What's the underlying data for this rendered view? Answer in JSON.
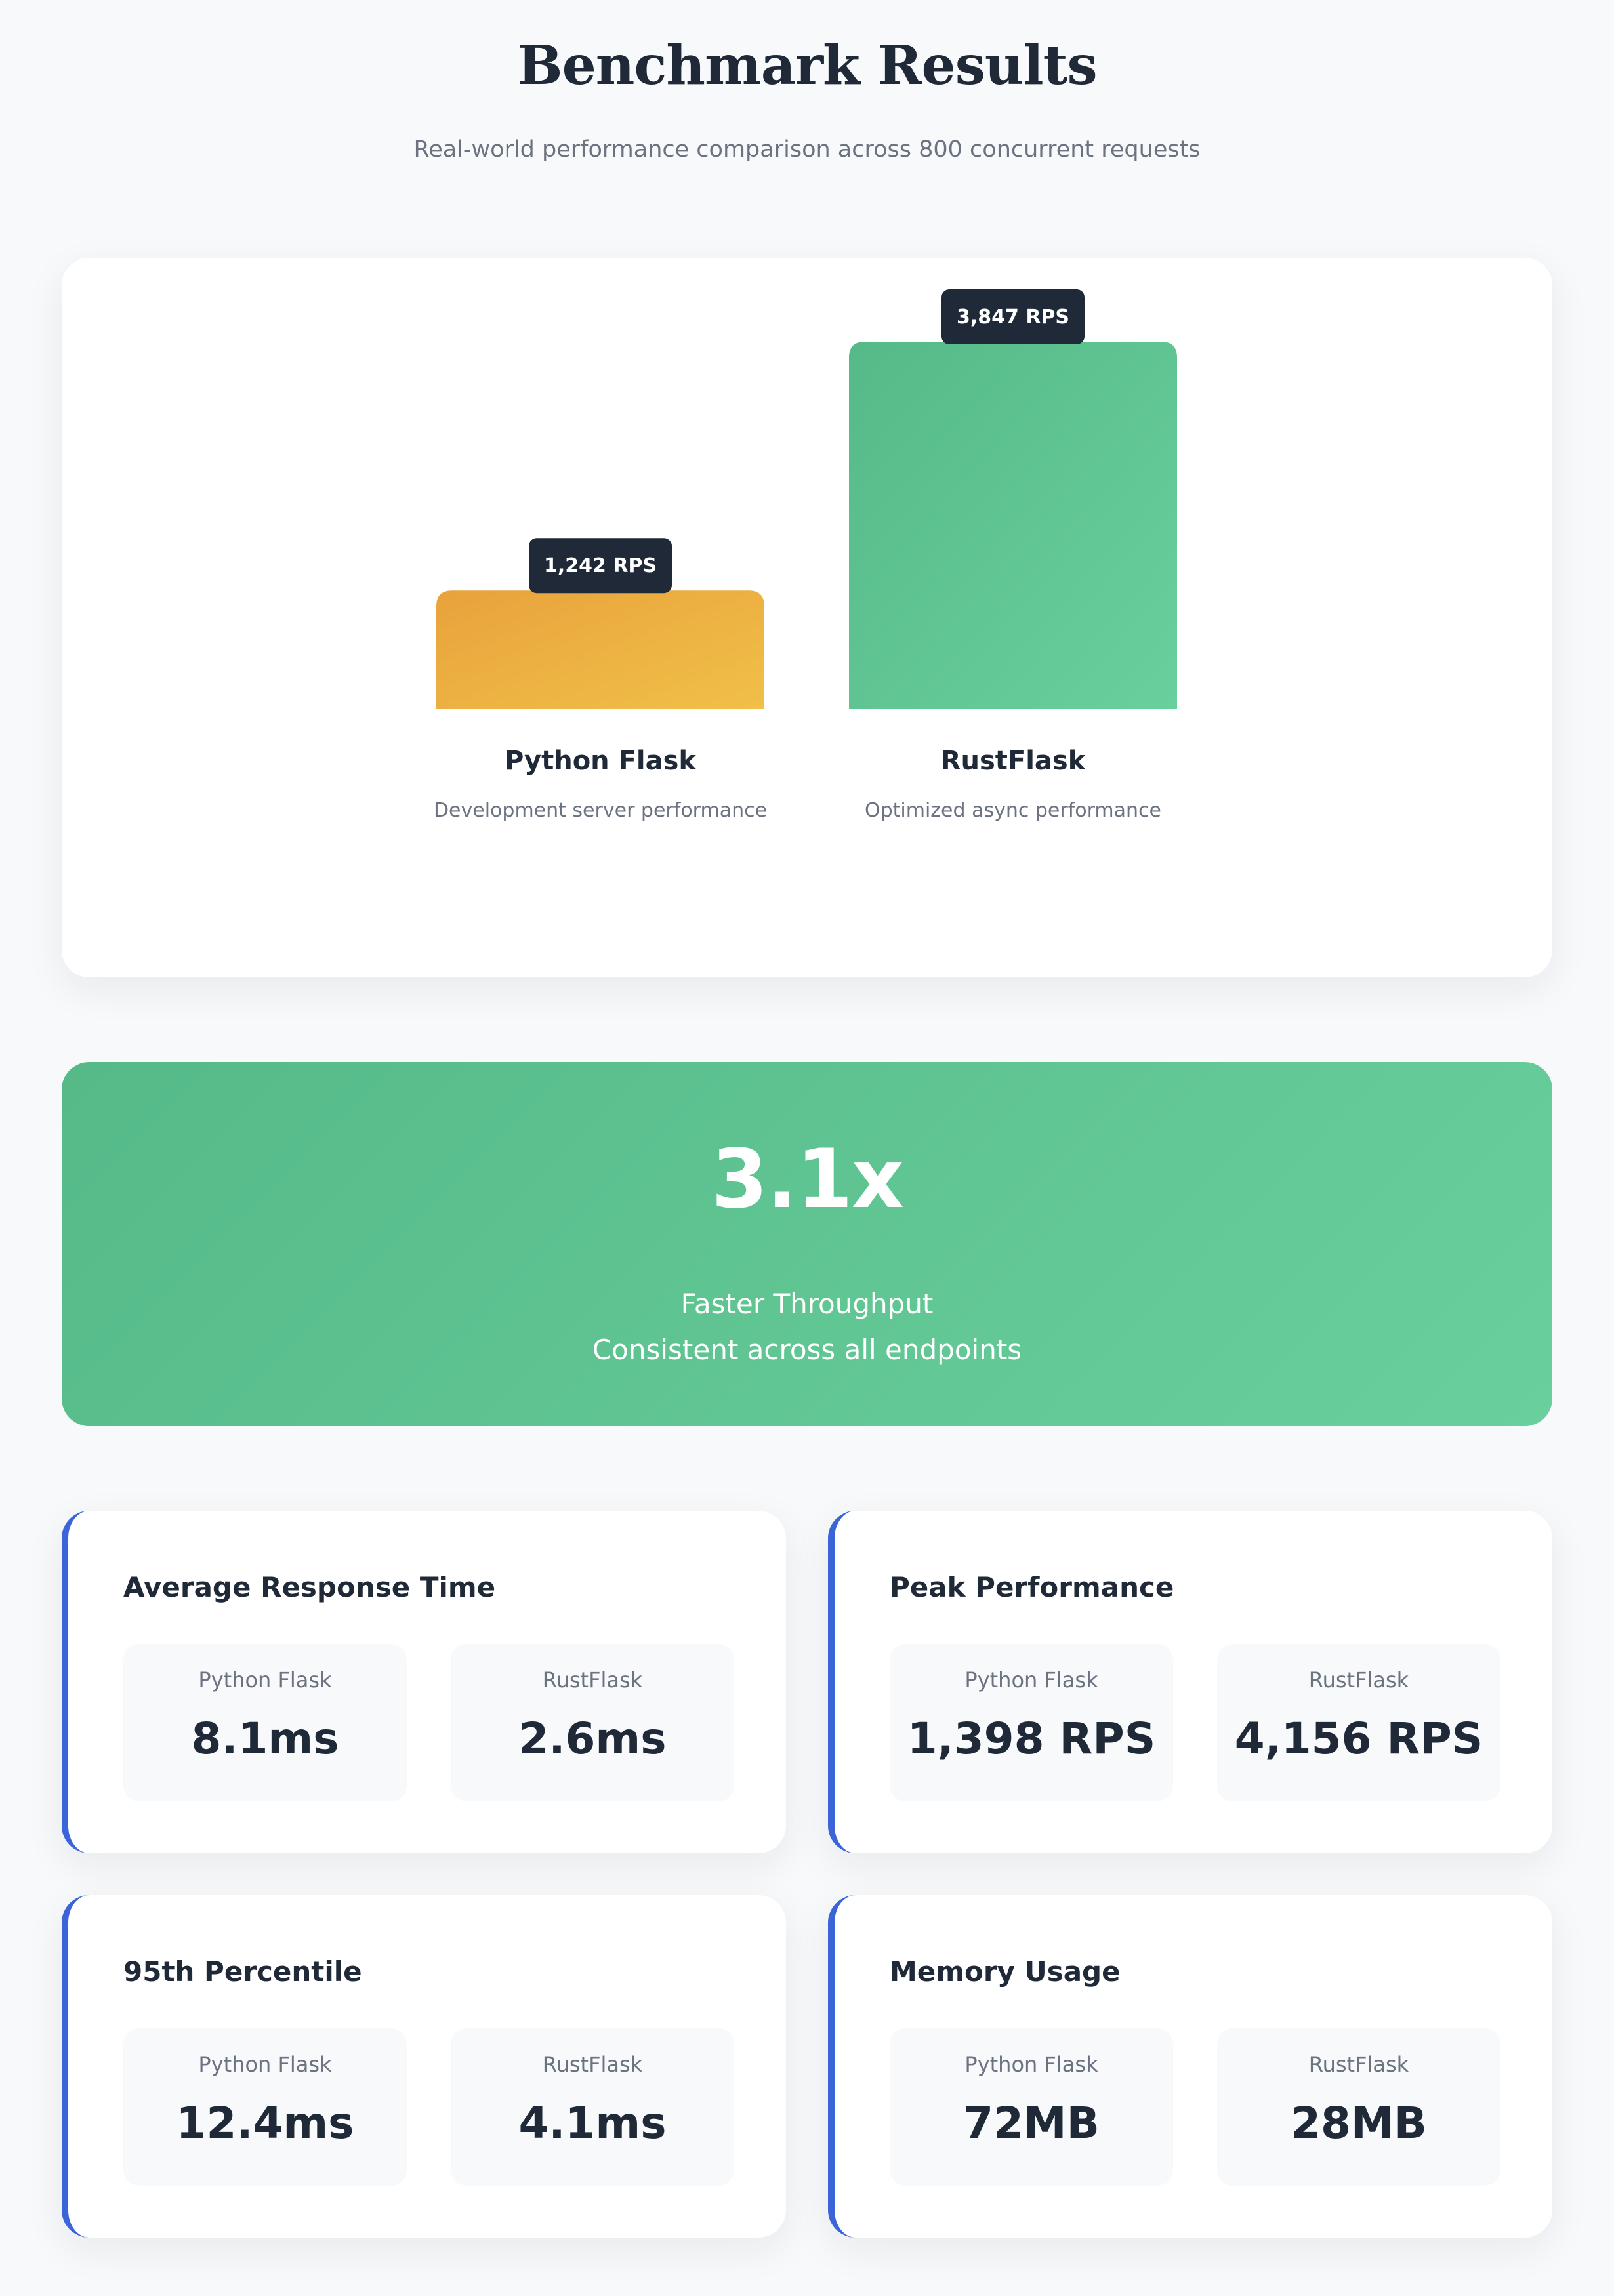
{
  "header": {
    "title": "Benchmark Results",
    "subtitle": "Real-world performance comparison across 800 concurrent requests"
  },
  "chart_data": {
    "type": "bar",
    "title": "",
    "xlabel": "",
    "ylabel": "",
    "unit": "RPS",
    "categories": [
      "Python Flask",
      "RustFlask"
    ],
    "values": [
      1242,
      3847
    ],
    "value_labels": [
      "1,242 RPS",
      "3,847 RPS"
    ],
    "descriptions": [
      "Development server performance",
      "Optimized async performance"
    ],
    "colors": [
      [
        "#e8a23c",
        "#f1c048"
      ],
      [
        "#55b988",
        "#69d09d"
      ]
    ],
    "grid": false,
    "ylim": [
      0,
      3847
    ]
  },
  "highlight": {
    "value": "3.1x",
    "line1": "Faster Throughput",
    "line2": "Consistent across all endpoints"
  },
  "metrics": [
    {
      "title": "Average Response Time",
      "left_label": "Python Flask",
      "left_value": "8.1ms",
      "right_label": "RustFlask",
      "right_value": "2.6ms"
    },
    {
      "title": "Peak Performance",
      "left_label": "Python Flask",
      "left_value": "1,398 RPS",
      "right_label": "RustFlask",
      "right_value": "4,156 RPS"
    },
    {
      "title": "95th Percentile",
      "left_label": "Python Flask",
      "left_value": "12.4ms",
      "right_label": "RustFlask",
      "right_value": "4.1ms"
    },
    {
      "title": "Memory Usage",
      "left_label": "Python Flask",
      "left_value": "72MB",
      "right_label": "RustFlask",
      "right_value": "28MB"
    }
  ],
  "colors": {
    "accent": "#3b64d8",
    "text": "#1f2937",
    "muted": "#6b7280",
    "label_bg": "#1f2937"
  }
}
